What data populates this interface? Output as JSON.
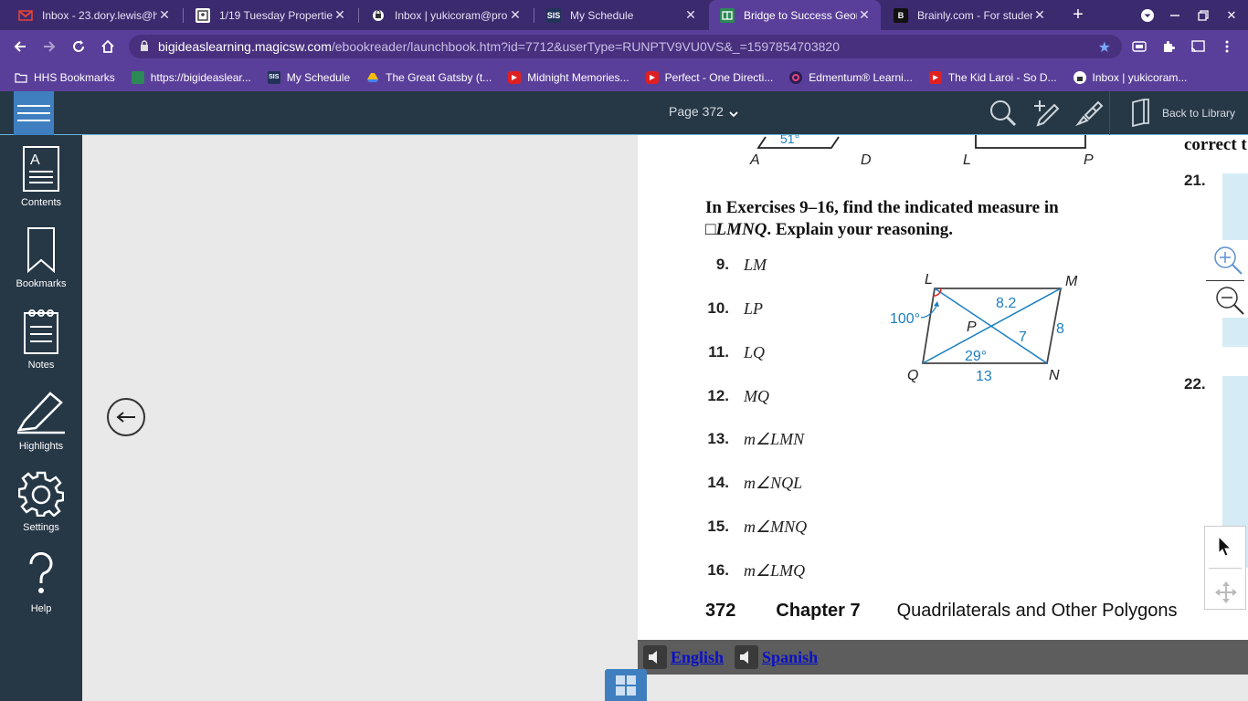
{
  "browser": {
    "tabs": [
      {
        "title": "Inbox - 23.dory.lewis@h",
        "icon": "gmail-icon",
        "active": false
      },
      {
        "title": "1/19 Tuesday Propertie",
        "icon": "classroom-icon",
        "active": false
      },
      {
        "title": "Inbox | yukicoram@pro",
        "icon": "mail-icon",
        "active": false
      },
      {
        "title": "My Schedule",
        "icon": "sis-icon",
        "active": false
      },
      {
        "title": "Bridge to Success Geom",
        "icon": "bigideas-icon",
        "active": true
      },
      {
        "title": "Brainly.com - For studen",
        "icon": "brainly-icon",
        "active": false
      }
    ],
    "url_host": "bigideaslearning.magicsw.com",
    "url_path": "/ebookreader/launchbook.htm?id=7712&userType=RUNPTV9VU0VS&_=1597854703820",
    "bookmarks": [
      {
        "label": "HHS Bookmarks",
        "icon": "folder-icon"
      },
      {
        "label": "https://bigideaslear...",
        "icon": "bigideas-icon"
      },
      {
        "label": "My Schedule",
        "icon": "sis-icon"
      },
      {
        "label": "The Great Gatsby (t...",
        "icon": "drive-icon"
      },
      {
        "label": "Midnight Memories...",
        "icon": "youtube-icon"
      },
      {
        "label": "Perfect - One Directi...",
        "icon": "youtube-icon"
      },
      {
        "label": "Edmentum® Learni...",
        "icon": "edmentum-icon"
      },
      {
        "label": "The Kid Laroi - So D...",
        "icon": "youtube-icon"
      },
      {
        "label": "Inbox | yukicoram...",
        "icon": "mail-icon"
      }
    ],
    "icon_labels": {
      "sis": "SIS",
      "brainly": "B"
    }
  },
  "reader": {
    "page_label": "Page 372",
    "back_label": "Back to Library"
  },
  "sidebar": [
    {
      "label": "Contents",
      "icon": "contents-icon"
    },
    {
      "label": "Bookmarks",
      "icon": "bookmark-icon"
    },
    {
      "label": "Notes",
      "icon": "notes-icon"
    },
    {
      "label": "Highlights",
      "icon": "highlighter-icon"
    },
    {
      "label": "Settings",
      "icon": "gear-icon"
    },
    {
      "label": "Help",
      "icon": "help-icon"
    }
  ],
  "page": {
    "top_figure": {
      "angle": "51°",
      "labels": [
        "A",
        "D",
        "L",
        "P"
      ]
    },
    "right_heading": "correct t",
    "heading_line1": "In Exercises 9–16, find the indicated measure in",
    "heading_line2": "□LMNQ",
    "heading_line2_suffix": ". Explain your reasoning.",
    "exercises": [
      {
        "num": "9.",
        "text": "LM"
      },
      {
        "num": "10.",
        "text": "LP"
      },
      {
        "num": "11.",
        "text": "LQ"
      },
      {
        "num": "12.",
        "text": "MQ"
      },
      {
        "num": "13.",
        "text": "m∠LMN"
      },
      {
        "num": "14.",
        "text": "m∠NQL"
      },
      {
        "num": "15.",
        "text": "m∠MNQ"
      },
      {
        "num": "16.",
        "text": "m∠LMQ"
      }
    ],
    "figure": {
      "vertices": [
        "L",
        "M",
        "N",
        "Q",
        "P"
      ],
      "measures": [
        "8.2",
        "8",
        "7",
        "13",
        "29°",
        "100°"
      ]
    },
    "side_numbers": [
      "21.",
      "22."
    ],
    "footer": {
      "page": "372",
      "chapter": "Chapter 7",
      "title": "Quadrilaterals and Other Polygons"
    }
  },
  "audio": {
    "english": "English",
    "spanish": "Spanish"
  },
  "colors": {
    "browser_dark": "#3c2a6e",
    "browser": "#5a3f9a",
    "reader_bar": "#263746",
    "accent_blue": "#3f7fbf",
    "figure_blue": "#1a7fc0"
  }
}
